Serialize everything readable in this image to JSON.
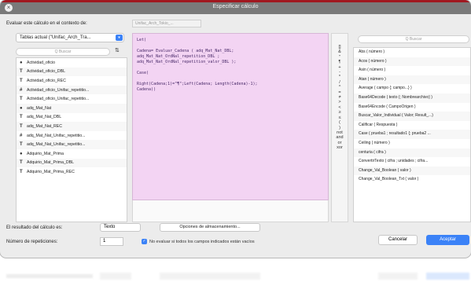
{
  "window": {
    "title": "Especificar cálculo",
    "close_glyph": "×"
  },
  "context": {
    "label": "Evaluar este cálculo en el contexto de:",
    "value": "Unifac_Arch_Tokio_..."
  },
  "tables_select": {
    "value": "Tablas actual (\"Unifac_Arch_Tra..."
  },
  "field_search": {
    "placeholder": "Q Buscar"
  },
  "fields": [
    {
      "icon": "●",
      "label": "Actividad_oficio"
    },
    {
      "icon": "T",
      "label": "Actividad_oficio_DBL"
    },
    {
      "icon": "T",
      "label": "Actividad_oficio_REC"
    },
    {
      "icon": "#",
      "label": "Actividad_oficio_Unifac_repetitio..."
    },
    {
      "icon": "T",
      "label": "Actividad_oficio_Unifac_repetitio..."
    },
    {
      "icon": "●",
      "label": "adq_Mat_Nat"
    },
    {
      "icon": "T",
      "label": "adq_Mat_Nat_DBL"
    },
    {
      "icon": "T",
      "label": "adq_Mat_Nat_REC"
    },
    {
      "icon": "#",
      "label": "adq_Mat_Nat_Unifac_repetitio..."
    },
    {
      "icon": "T",
      "label": "adq_Mat_Nat_Unifac_repetitio..."
    },
    {
      "icon": "●",
      "label": "Adquirio_Mat_Prima"
    },
    {
      "icon": "T",
      "label": "Adquirio_Mat_Prima_DBL"
    },
    {
      "icon": "T",
      "label": "Adquirio_Mat_Prima_REC"
    }
  ],
  "code_lines": [
    "Let(",
    "",
    "Cadena= Evaluar_Cadena ( adq_Mat_Nat_DBL;",
    "adq_Mat_Nat_OrdNal_repetition_DBL ;",
    "adq_Mat_Nat_OrdNal_repetition_valor_DBL );",
    "",
    "Case(",
    "",
    "Right(Cadena;1)=\"¶\";Left(Cadena; Length(Cadena)-1);",
    "Cadena))"
  ],
  "operators": [
    "[]",
    "&",
    "\"",
    "¶",
    "+",
    "-",
    "*",
    "/",
    "^",
    "=",
    "≠",
    ">",
    "<",
    "≥",
    "≤",
    "(",
    ")",
    "not",
    "and",
    "or",
    "xor"
  ],
  "function_search": {
    "placeholder": "Q Buscar"
  },
  "functions": [
    "Abs ( número )",
    "Acos ( número )",
    "Asin ( número )",
    "Atan ( número )",
    "Average ( campo {; campo...} )",
    "Base64Decode ( texto {; Nombrearchivo} )",
    "Base64Encode ( CampoOrigen )",
    "Buscar_Valor_Individual ( Valor; Result_...)",
    "Calificar ( Respuesta )",
    "Case ( prueba1 ; resultado1 {; prueba2 ...",
    "Ceiling ( número )",
    "centuria ( cifra )",
    "ConvertirTexto ( cifra ; unidades ; cifra...",
    "Change_Val_Boolean ( valor )",
    "Change_Val_Boolean_Txt ( valor )"
  ],
  "result": {
    "label": "El resultado del cálculo es:",
    "value": "Texto"
  },
  "storage_button": {
    "label": "Opciones de almacenamiento..."
  },
  "repetitions": {
    "label": "Número de repeticiones:",
    "value": "1"
  },
  "no_eval": {
    "checked_glyph": "✓",
    "label": "No evaluar si todos los campos indicados están vacíos"
  },
  "buttons": {
    "cancel": "Cancelar",
    "ok": "Aceptar"
  },
  "colors": {
    "editor_bg": "#f3d4f3",
    "accent": "#3b82f7",
    "titlebar": "#7a7a7a",
    "title_border": "#a01820"
  }
}
